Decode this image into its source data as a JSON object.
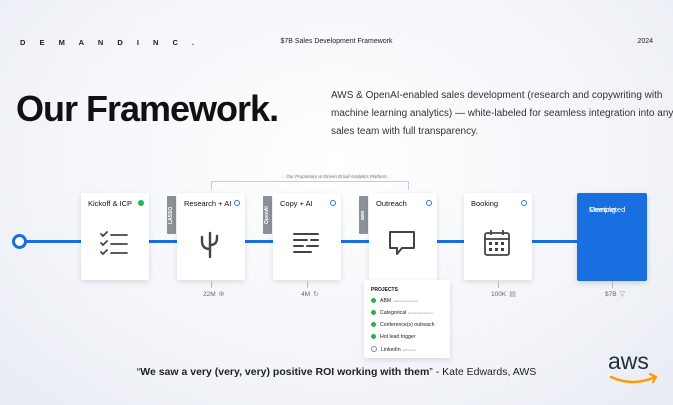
{
  "header": {
    "brand": "D E M A N D   I N C .",
    "subtitle": "$7B Sales Development Framework",
    "year": "2024"
  },
  "title": "Our Framework.",
  "description": [
    "AWS & OpenAI-enabled sales development (research and copywriting with",
    "machine learning analytics) — white-labeled for seamless integration into any",
    "sales team with full transparency."
  ],
  "platform_label": "Our Proprietary AI-Driven Email Analytics Platform",
  "steps": [
    {
      "label": "Kickoff & ICP",
      "status": "green",
      "icon": "checklist-icon"
    },
    {
      "label": "Research + AI",
      "status": "blue",
      "icon": "cactus-icon",
      "badge": "LASSO",
      "metric": "22M",
      "metric_icon": "globe-icon"
    },
    {
      "label": "Copy + AI",
      "status": "blue",
      "icon": "text-lines-icon",
      "badge": "OpenAI",
      "metric": "4M",
      "metric_icon": "refresh-icon"
    },
    {
      "label": "Outreach",
      "status": "blue",
      "icon": "chat-bubble-icon",
      "badge": "aws"
    },
    {
      "label": "Booking",
      "status": "blue",
      "icon": "calendar-icon",
      "metric": "100K",
      "metric_icon": "calendar-small-icon"
    }
  ],
  "final_step": {
    "label_line1": "Meeting",
    "label_line2": "Completed",
    "metric": "$7B",
    "metric_icon": "filter-icon"
  },
  "projects": {
    "title": "PROJECTS",
    "items": [
      {
        "label": "ABM",
        "sub": "(Named Accounts)",
        "done": true
      },
      {
        "label": "Categorical",
        "sub": "(Persona & Firmo)",
        "done": true
      },
      {
        "label": "Conference(s) outreach",
        "sub": "",
        "done": true
      },
      {
        "label": "Hot lead trigger",
        "sub": "",
        "done": true
      },
      {
        "label": "LinkedIn",
        "sub": "(Inbound)",
        "done": false
      }
    ]
  },
  "quote": {
    "open": "“",
    "text": "We saw a very (very, very) positive ROI working with them",
    "close": "”",
    "attribution": " - Kate Edwards, AWS"
  },
  "logo": "aws",
  "colors": {
    "accent": "#1a6fe0",
    "green": "#2bb24c"
  }
}
